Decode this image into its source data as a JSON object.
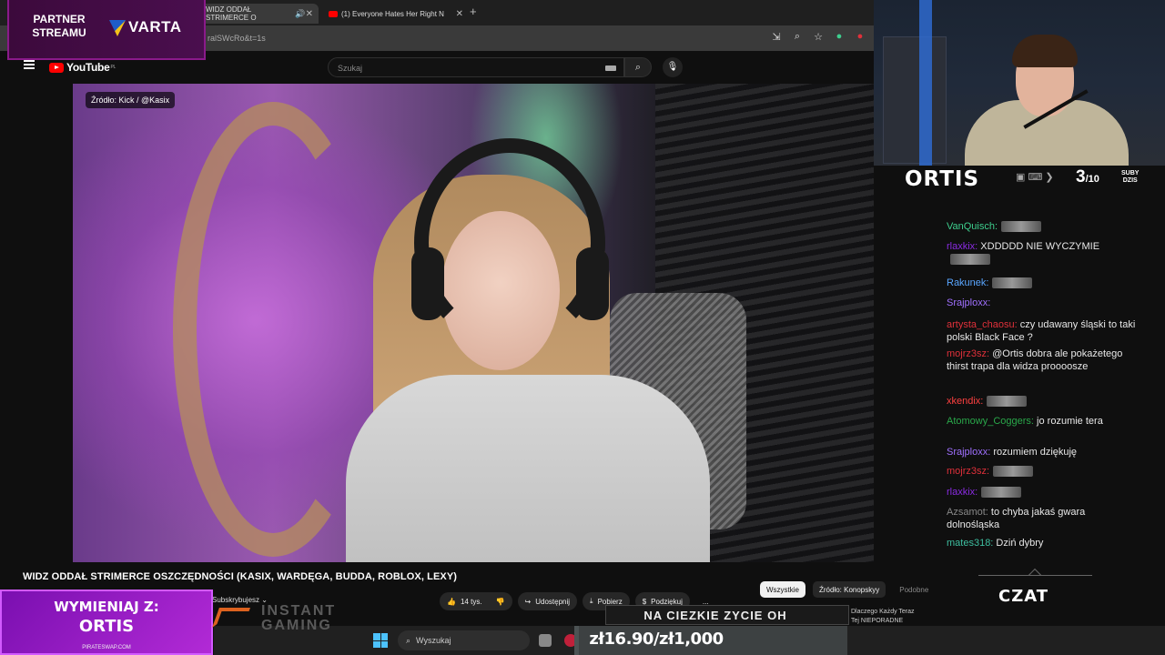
{
  "browser": {
    "tabs": [
      {
        "label": "WIDZ ODDAŁ STRIMERCE O",
        "active": true,
        "audio": true
      },
      {
        "label": "(1) Everyone Hates Her Right N"
      }
    ],
    "new_tab": "+",
    "close": "✕",
    "url": "ralSWcRo&t=1s"
  },
  "youtube": {
    "logo": "YouTube",
    "region": "PL",
    "search_placeholder": "Szukaj",
    "video": {
      "source_badge": "Źródło: Kick / @Kasix",
      "title": "WIDZ ODDAŁ STRIMERCE OSZCZĘDNOŚCI (KASIX, WARDĘGA, BUDDA, ROBLOX, LEXY)",
      "subscribe_label": "Subskrybujesz",
      "likes": "14 tys.",
      "share": "Udostępnij",
      "download": "Pobierz",
      "thanks": "Podziękuj",
      "more": "..."
    },
    "chips": [
      "Wszystkie",
      "Źródło: Konopskyy",
      "Podobne"
    ],
    "recommendation_preview": [
      "Dlaczego Każdy Teraz",
      "Tej NIEPORADNE"
    ]
  },
  "taskbar": {
    "search_placeholder": "Wyszukaj"
  },
  "overlay": {
    "partner": {
      "label": "PARTNER STREAMU",
      "brand": "VARTA"
    },
    "streamer": "ORTIS",
    "subs_today": {
      "current": "3",
      "goal": "/10",
      "label_top": "SUBY",
      "label_bottom": "DZIS"
    },
    "chat_label": "CZAT",
    "chat": [
      {
        "user": "VanQuisch:",
        "color": "#3ecf8e",
        "text": "",
        "emote": true
      },
      {
        "user": "rlaxkix:",
        "color": "#8a2be2",
        "text": "XDDDDD NIE WYCZYMIE",
        "emote": true
      },
      {
        "user": "Rakunek:",
        "color": "#5aa6ff",
        "text": "",
        "emote": true
      },
      {
        "user": "Srajploxx:",
        "color": "#a070ff",
        "text": "",
        "emote": false
      },
      {
        "user": "artysta_chaosu:",
        "color": "#e0303a",
        "text": "czy udawany śląski to taki polski Black Face ?",
        "emote": false
      },
      {
        "user": "mojrz3sz:",
        "color": "#e0303a",
        "text": "@Ortis dobra ale pokażetego thirst trapa dla widza prooooszе",
        "emote": false
      },
      {
        "user": "xkendix:",
        "color": "#ff4040",
        "text": "",
        "emote": true
      },
      {
        "user": "Atomowy_Coggers:",
        "color": "#2aa84a",
        "text": "jo rozumie tera",
        "emote": false
      },
      {
        "user": "Srajploxx:",
        "color": "#a070ff",
        "text": "rozumiem dziękuję",
        "emote": false
      },
      {
        "user": "mojrz3sz:",
        "color": "#e0303a",
        "text": "",
        "emote": true
      },
      {
        "user": "rlaxkix:",
        "color": "#8a2be2",
        "text": "",
        "emote": true
      },
      {
        "user": "Azsamot:",
        "color": "#888888",
        "text": "to chyba jakaś gwara dolnośląska",
        "emote": false
      },
      {
        "user": "mates318:",
        "color": "#3ebfa0",
        "text": "Dziń dybry",
        "emote": false
      }
    ],
    "exchange": {
      "line1": "WYMIENIAJ Z:",
      "line2": "ORTIS",
      "site": "PIRATESWAP.COM"
    },
    "instant_gaming": "INSTANT GAMING",
    "goal_text": "NA CIEZKIE ZYCIE OH",
    "money": {
      "text": "zł16.90/zł1,000",
      "fraction": 0.0169
    }
  },
  "colors": {
    "accent": "#ff0000",
    "overlay_purple": "#b22ad6",
    "taskbar_blue": "#4cc2ff"
  }
}
